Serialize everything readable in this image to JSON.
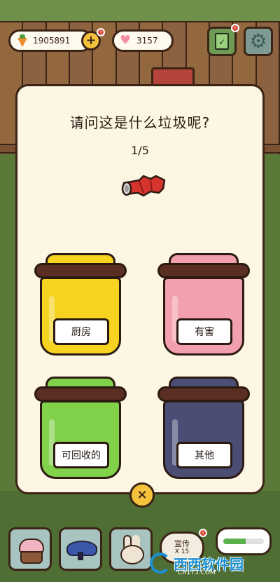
{
  "hud": {
    "carrots": "1905891",
    "hearts": "3157",
    "plus_label": "+",
    "badge_label": "!"
  },
  "modal": {
    "title": "请问这是什么垃圾呢?",
    "progress": "1/5",
    "item_icon": "crushed-soda-can-icon",
    "close_label": "×"
  },
  "bins": [
    {
      "label": "厨房",
      "color": "#f5d320"
    },
    {
      "label": "有害",
      "color": "#f3a0ae"
    },
    {
      "label": "可回收的",
      "color": "#82d14a"
    },
    {
      "label": "其他",
      "color": "#4a4e75"
    }
  ],
  "toolbar": {
    "promo_label": "宣传",
    "promo_count": "X 15",
    "progress_fraction": 0.55
  },
  "watermark": {
    "text": "西西软件园",
    "domain": "CR173.COM"
  }
}
